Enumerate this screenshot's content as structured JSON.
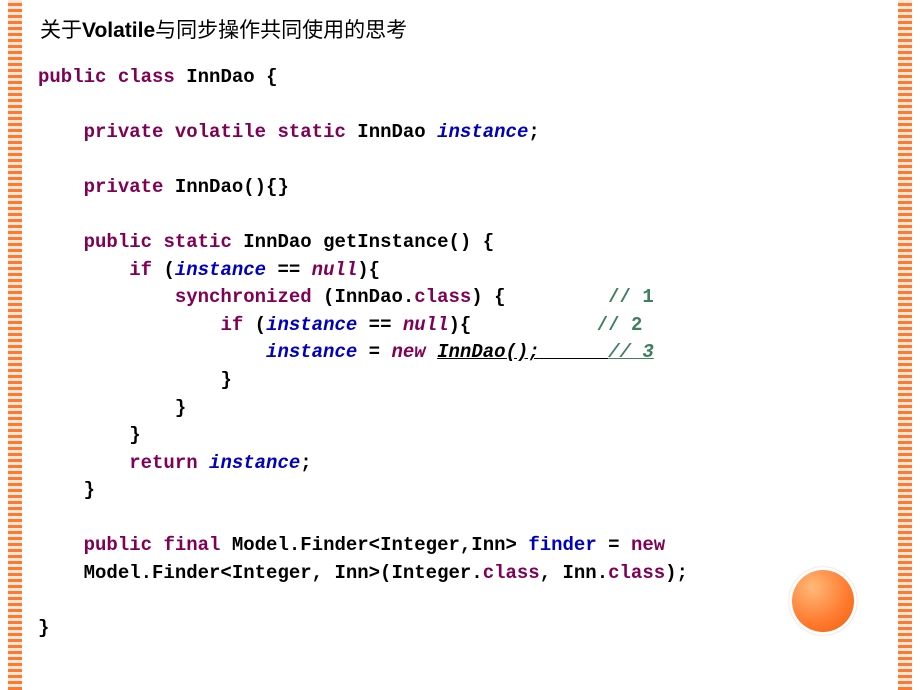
{
  "title_prefix": "关于",
  "title_bold": "Volatile",
  "title_suffix": "与同步操作共同使用的思考",
  "code": {
    "l1_kw1": "public",
    "l1_kw2": "class",
    "l1_name": "InnDao {",
    "l2_kw1": "private",
    "l2_kw2": "volatile",
    "l2_kw3": "static",
    "l2_type": "InnDao",
    "l2_var": "instance",
    "l2_end": ";",
    "l3_kw1": "private",
    "l3_rest": "InnDao(){}",
    "l4_kw1": "public",
    "l4_kw2": "static",
    "l4_rest": "InnDao getInstance() {",
    "l5_kw1": "if",
    "l5_open": "(",
    "l5_var": "instance",
    "l5_eq": " == ",
    "l5_null": "null",
    "l5_close": "){",
    "l6_kw1": "synchronized",
    "l6_rest": " (InnDao.",
    "l6_kw2": "class",
    "l6_close": ") {",
    "l6_pad": "         ",
    "l6_cmt": "// 1",
    "l7_kw1": "if",
    "l7_open": " (",
    "l7_var": "instance",
    "l7_eq": " == ",
    "l7_null": "null",
    "l7_close": "){",
    "l7_pad": "           ",
    "l7_cmt": "// 2",
    "l8_var": "instance",
    "l8_eq": " = ",
    "l8_new": "new",
    "l8_sp": " ",
    "l8_ctor": "InnDao();",
    "l8_pad": "      ",
    "l8_cmt": "// 3",
    "l9": "}",
    "l10": "}",
    "l11": "}",
    "l12_kw": "return",
    "l12_sp": " ",
    "l12_var": "instance",
    "l12_end": ";",
    "l13": "}",
    "l14_kw1": "public",
    "l14_kw2": "final",
    "l14_rest1": " Model.Finder<Integer,Inn> ",
    "l14_field": "finder",
    "l14_eq": " = ",
    "l14_kw3": "new",
    "l15_rest": "Model.Finder<Integer, Inn>(Integer.",
    "l15_kw1": "class",
    "l15_mid": ", Inn.",
    "l15_kw2": "class",
    "l15_end": ");",
    "l16": "}"
  }
}
